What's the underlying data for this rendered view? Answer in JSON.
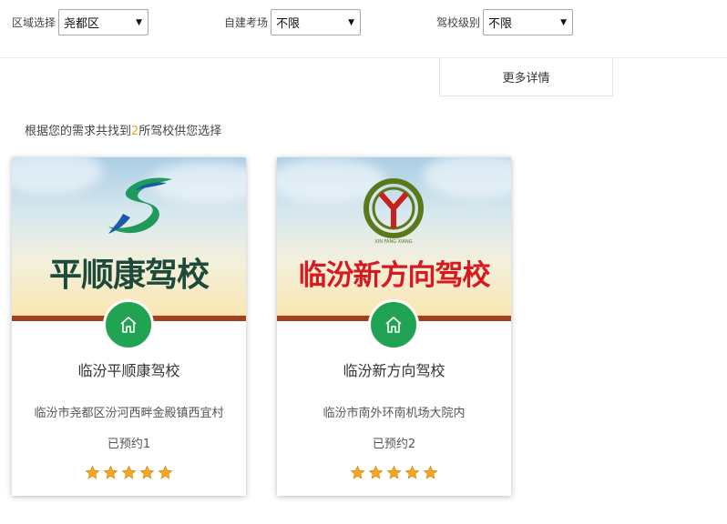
{
  "filters": {
    "district": {
      "label": "区域选择",
      "value": "尧都区"
    },
    "own_field": {
      "label": "自建考场",
      "value": "不限"
    },
    "school_level": {
      "label": "驾校级别",
      "value": "不限"
    }
  },
  "more_details": "更多详情",
  "result": {
    "prefix": "根据您的需求共找到",
    "count": "2",
    "suffix": "所驾校供您选择"
  },
  "schools": [
    {
      "banner_title": "平顺康驾校",
      "name": "临汾平顺康驾校",
      "address": "临汾市尧都区汾河西畔金殿镇西宜村",
      "booked": "已预约1",
      "rating": 5
    },
    {
      "banner_title": "临汾新方向驾校",
      "logo_text": "XIN FANG XIANG",
      "name": "临汾新方向驾校",
      "address": "临汾市南外环南机场大院内",
      "booked": "已预约2",
      "rating": 5
    }
  ],
  "colors": {
    "accent_count": "#f0a020",
    "badge_green": "#22a354",
    "divider_brown": "#a0401c",
    "title_dark_green": "#1d4a3a",
    "title_red": "#d71920",
    "star": "#f5a623"
  }
}
